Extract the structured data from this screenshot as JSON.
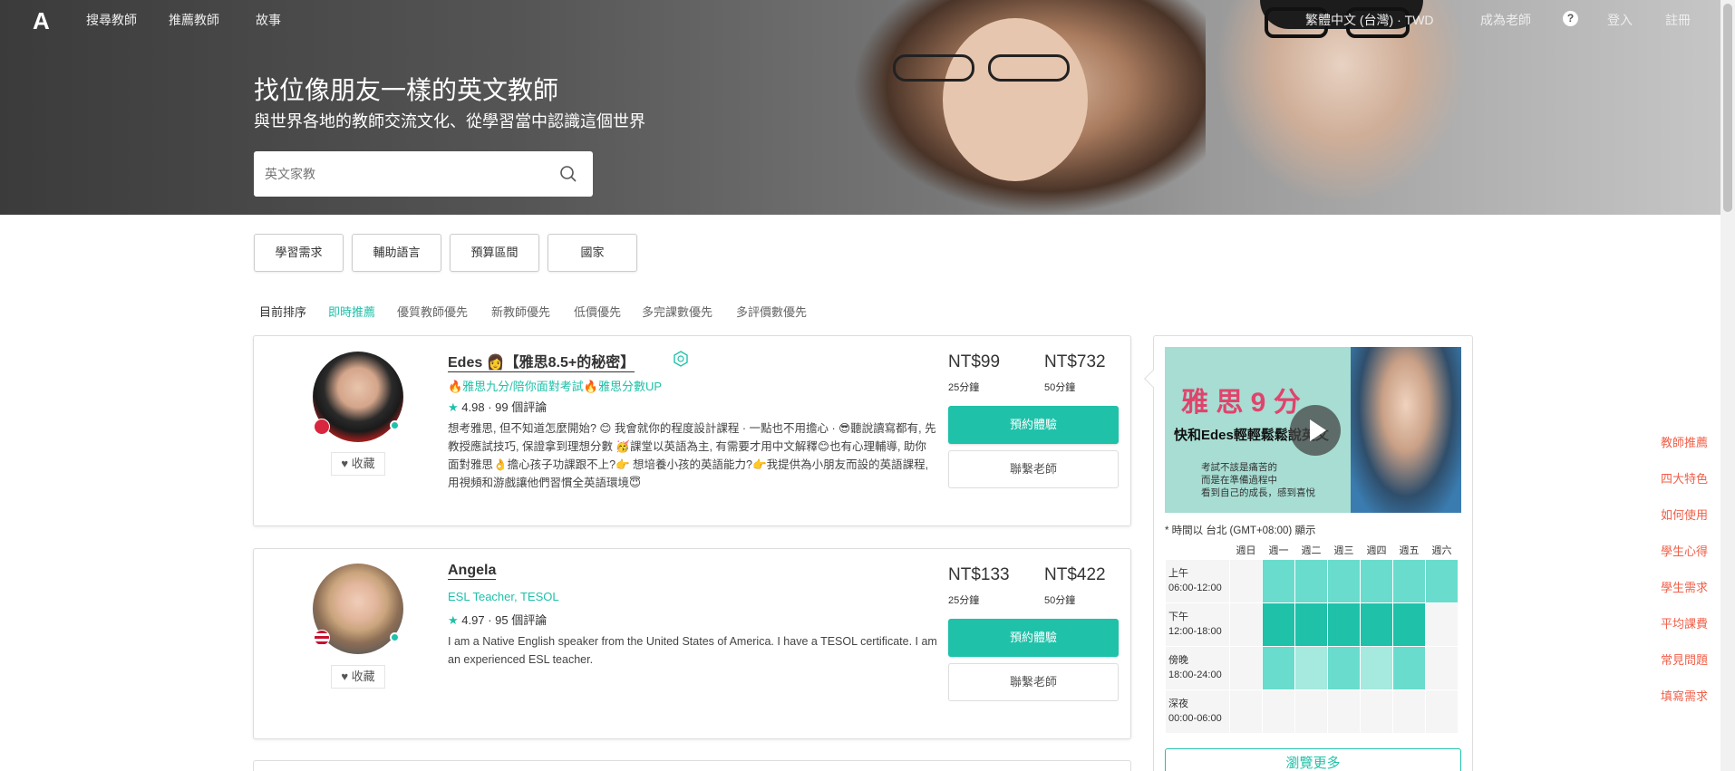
{
  "nav": {
    "logo": "A",
    "left_items": [
      "搜尋教師",
      "推薦教師",
      "故事"
    ],
    "language": "繁體中文 (台灣) · TWD",
    "become_teacher": "成為老師",
    "help": "?",
    "login": "登入",
    "register": "註冊"
  },
  "hero": {
    "title": "找位像朋友一樣的英文教師",
    "subtitle": "與世界各地的教師交流文化、從學習當中認識這個世界",
    "search_placeholder": "英文家教"
  },
  "filters": [
    "學習需求",
    "輔助語言",
    "預算區間",
    "國家"
  ],
  "sort": {
    "label": "目前排序",
    "options": [
      "即時推薦",
      "優質教師優先",
      "新教師優先",
      "低價優先",
      "多完課數優先",
      "多評價數優先"
    ],
    "active_index": 0
  },
  "teachers": [
    {
      "name": "Edes 👩【雅思8.5+的秘密】",
      "tagline": "🔥雅思九分/陪你面對考試🔥雅思分數UP",
      "rating": "4.98",
      "reviews": "99 個評論",
      "intro": "想考雅思, 但不知道怎麼開始? 😊 我會就你的程度設計課程 · 一點也不用擔心 · 😎聽說讀寫都有, 先教授應試技巧, 保證拿到理想分數 🥳課堂以英語為主, 有需要才用中文解釋😊也有心理輔導, 助你面對雅思👌擔心孩子功課跟不上?👉 想培養小孩的英語能力?👉我提供為小朋友而設的英語課程, 用視頻和游戲讓他們習慣全英語環境😇",
      "price_trial": "NT$99",
      "trial_unit": "25分鐘",
      "price_full": "NT$732",
      "full_unit": "50分鐘",
      "favorite": "收藏",
      "trial_btn": "預約體驗",
      "contact_btn": "聯繫老師",
      "flag_color": "#d7263d"
    },
    {
      "name": "Angela",
      "tagline": "ESL Teacher, TESOL",
      "rating": "4.97",
      "reviews": "95 個評論",
      "intro": "I am a Native English speaker from the United States of America. I have a TESOL certificate. I am an experienced ESL teacher.",
      "price_trial": "NT$133",
      "trial_unit": "25分鐘",
      "price_full": "NT$422",
      "full_unit": "50分鐘",
      "favorite": "收藏",
      "trial_btn": "預約體驗",
      "contact_btn": "聯繫老師",
      "flag_color": "#3c5ba9"
    }
  ],
  "preview": {
    "video_big_text": "雅 思 9 分",
    "video_caption": "快和Edes輕輕鬆鬆說英文",
    "video_note_lines": [
      "考試不該是痛苦的",
      "而是在準備過程中",
      "看到自己的成長，感到喜悅"
    ],
    "timezone_note": "* 時間以 台北 (GMT+08:00) 顯示",
    "days": [
      "週日",
      "週一",
      "週二",
      "週三",
      "週四",
      "週五",
      "週六"
    ],
    "slots": [
      {
        "label": "上午",
        "time": "06:00-12:00",
        "levels": [
          0,
          2,
          2,
          2,
          2,
          2,
          2
        ]
      },
      {
        "label": "下午",
        "time": "12:00-18:00",
        "levels": [
          0,
          3,
          3,
          3,
          3,
          3,
          0
        ]
      },
      {
        "label": "傍晚",
        "time": "18:00-24:00",
        "levels": [
          0,
          2,
          1,
          2,
          1,
          2,
          0
        ]
      },
      {
        "label": "深夜",
        "time": "00:00-06:00",
        "levels": [
          0,
          0,
          0,
          0,
          0,
          0,
          0
        ]
      }
    ],
    "browse_more": "瀏覽更多"
  },
  "side_links": [
    "教師推薦",
    "四大特色",
    "如何使用",
    "學生心得",
    "學生需求",
    "平均課費",
    "常見問題",
    "填寫需求"
  ],
  "colors": {
    "accent": "#1fc1a9",
    "side_link": "#f0604a"
  }
}
